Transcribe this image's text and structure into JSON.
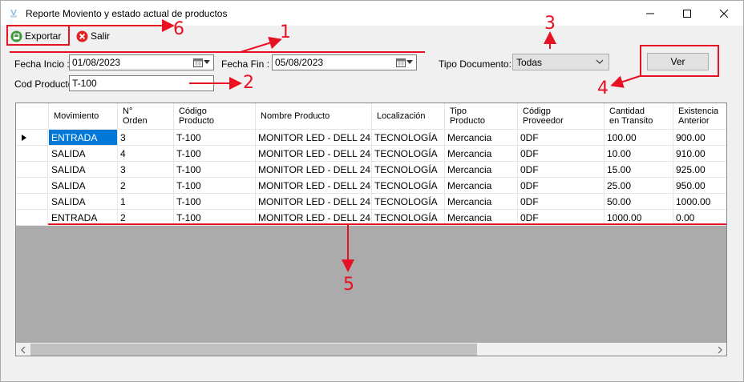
{
  "window": {
    "title": "Reporte Moviento y estado actual de productos",
    "icons": {
      "app": "app-icon",
      "minimize": "minimize-icon",
      "maximize": "maximize-icon",
      "close": "close-icon"
    }
  },
  "toolbar": {
    "export_label": "Exportar",
    "export_icon": "export-icon",
    "exit_label": "Salir",
    "exit_icon": "exit-icon"
  },
  "filters": {
    "fecha_inicio_label": "Fecha Incio :",
    "fecha_inicio_value": "01/08/2023",
    "fecha_fin_label": "Fecha Fin :",
    "fecha_fin_value": "05/08/2023",
    "tipo_documento_label": "Tipo Documento:",
    "tipo_documento_value": "Todas",
    "cod_producto_label": "Cod Producto:",
    "cod_producto_value": "T-100",
    "ver_label": "Ver"
  },
  "grid": {
    "columns": [
      "Movimiento",
      "N°\nOrden",
      "Código\nProducto",
      "Nombre Producto",
      "Localización",
      "Tipo\nProducto",
      "Códigp\nProveedor",
      "Cantidad\nen Transito",
      "Existencia\nAnterior"
    ],
    "rows": [
      [
        "ENTRADA",
        "3",
        "T-100",
        "MONITOR LED - DELL  24 \"",
        "TECNOLOGÍA",
        "Mercancia",
        "0DF",
        "100.00",
        "900.00"
      ],
      [
        "SALIDA",
        "4",
        "T-100",
        "MONITOR LED - DELL  24 \"",
        "TECNOLOGÍA",
        "Mercancia",
        "0DF",
        "10.00",
        "910.00"
      ],
      [
        "SALIDA",
        "3",
        "T-100",
        "MONITOR LED - DELL  24 \"",
        "TECNOLOGÍA",
        "Mercancia",
        "0DF",
        "15.00",
        "925.00"
      ],
      [
        "SALIDA",
        "2",
        "T-100",
        "MONITOR LED - DELL  24 \"",
        "TECNOLOGÍA",
        "Mercancia",
        "0DF",
        "25.00",
        "950.00"
      ],
      [
        "SALIDA",
        "1",
        "T-100",
        "MONITOR LED - DELL  24 \"",
        "TECNOLOGÍA",
        "Mercancia",
        "0DF",
        "50.00",
        "1000.00"
      ],
      [
        "ENTRADA",
        "2",
        "T-100",
        "MONITOR LED - DELL  24 \"",
        "TECNOLOGÍA",
        "Mercancia",
        "0DF",
        "1000.00",
        "0.00"
      ]
    ],
    "current_row_indicator": "row-pointer-icon"
  },
  "annotations": {
    "labels": [
      "1",
      "2",
      "3",
      "4",
      "5",
      "6"
    ],
    "color": "#e81123"
  },
  "colors": {
    "selection": "#0078d7",
    "grid_background": "#ababab",
    "annotation": "#e81123"
  }
}
